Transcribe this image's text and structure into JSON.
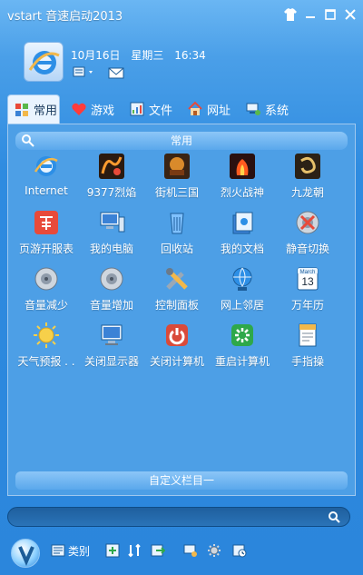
{
  "app": {
    "title": "vstart 音速启动2013",
    "colors": {
      "titlebar_text": "#ffffff",
      "accent_blue": "#2b86dc",
      "panel_bg": "#4d9fe6",
      "tab_active_bg": "#eaf4ff"
    }
  },
  "header": {
    "date": "10月16日",
    "weekday": "星期三",
    "time": "16:34"
  },
  "tabs": [
    {
      "label": "常用",
      "icon": "puzzle-icon",
      "active": true
    },
    {
      "label": "游戏",
      "icon": "heart-icon",
      "active": false
    },
    {
      "label": "文件",
      "icon": "chart-icon",
      "active": false
    },
    {
      "label": "网址",
      "icon": "home-icon",
      "active": false
    },
    {
      "label": "系统",
      "icon": "system-icon",
      "active": false
    }
  ],
  "panel": {
    "section_title": "常用",
    "bottom_bar": "自定义栏目一"
  },
  "items": [
    {
      "label": "Internet",
      "icon": "internet-icon"
    },
    {
      "label": "9377烈焰",
      "icon": "game-liyan-icon"
    },
    {
      "label": "街机三国",
      "icon": "game-sanguo-icon"
    },
    {
      "label": "烈火战神",
      "icon": "game-liehuo-icon"
    },
    {
      "label": "九龙朝",
      "icon": "game-jiulong-icon"
    },
    {
      "label": "页游开服表",
      "icon": "ye-icon"
    },
    {
      "label": "我的电脑",
      "icon": "computer-icon"
    },
    {
      "label": "回收站",
      "icon": "recycle-icon"
    },
    {
      "label": "我的文档",
      "icon": "documents-icon"
    },
    {
      "label": "静音切换",
      "icon": "mute-icon"
    },
    {
      "label": "音量减少",
      "icon": "volume-down-icon"
    },
    {
      "label": "音量增加",
      "icon": "volume-up-icon"
    },
    {
      "label": "控制面板",
      "icon": "control-panel-icon"
    },
    {
      "label": "网上邻居",
      "icon": "network-icon"
    },
    {
      "label": "万年历",
      "icon": "calendar-icon"
    },
    {
      "label": "天气预报 . .",
      "icon": "weather-icon"
    },
    {
      "label": "关闭显示器",
      "icon": "monitor-off-icon"
    },
    {
      "label": "关闭计算机",
      "icon": "shutdown-icon"
    },
    {
      "label": "重启计算机",
      "icon": "restart-icon"
    },
    {
      "label": "手指操",
      "icon": "finger-icon"
    }
  ],
  "calendar": {
    "month": "March",
    "day": "13"
  },
  "search": {
    "placeholder": ""
  },
  "footer": {
    "category_label": "类别"
  }
}
